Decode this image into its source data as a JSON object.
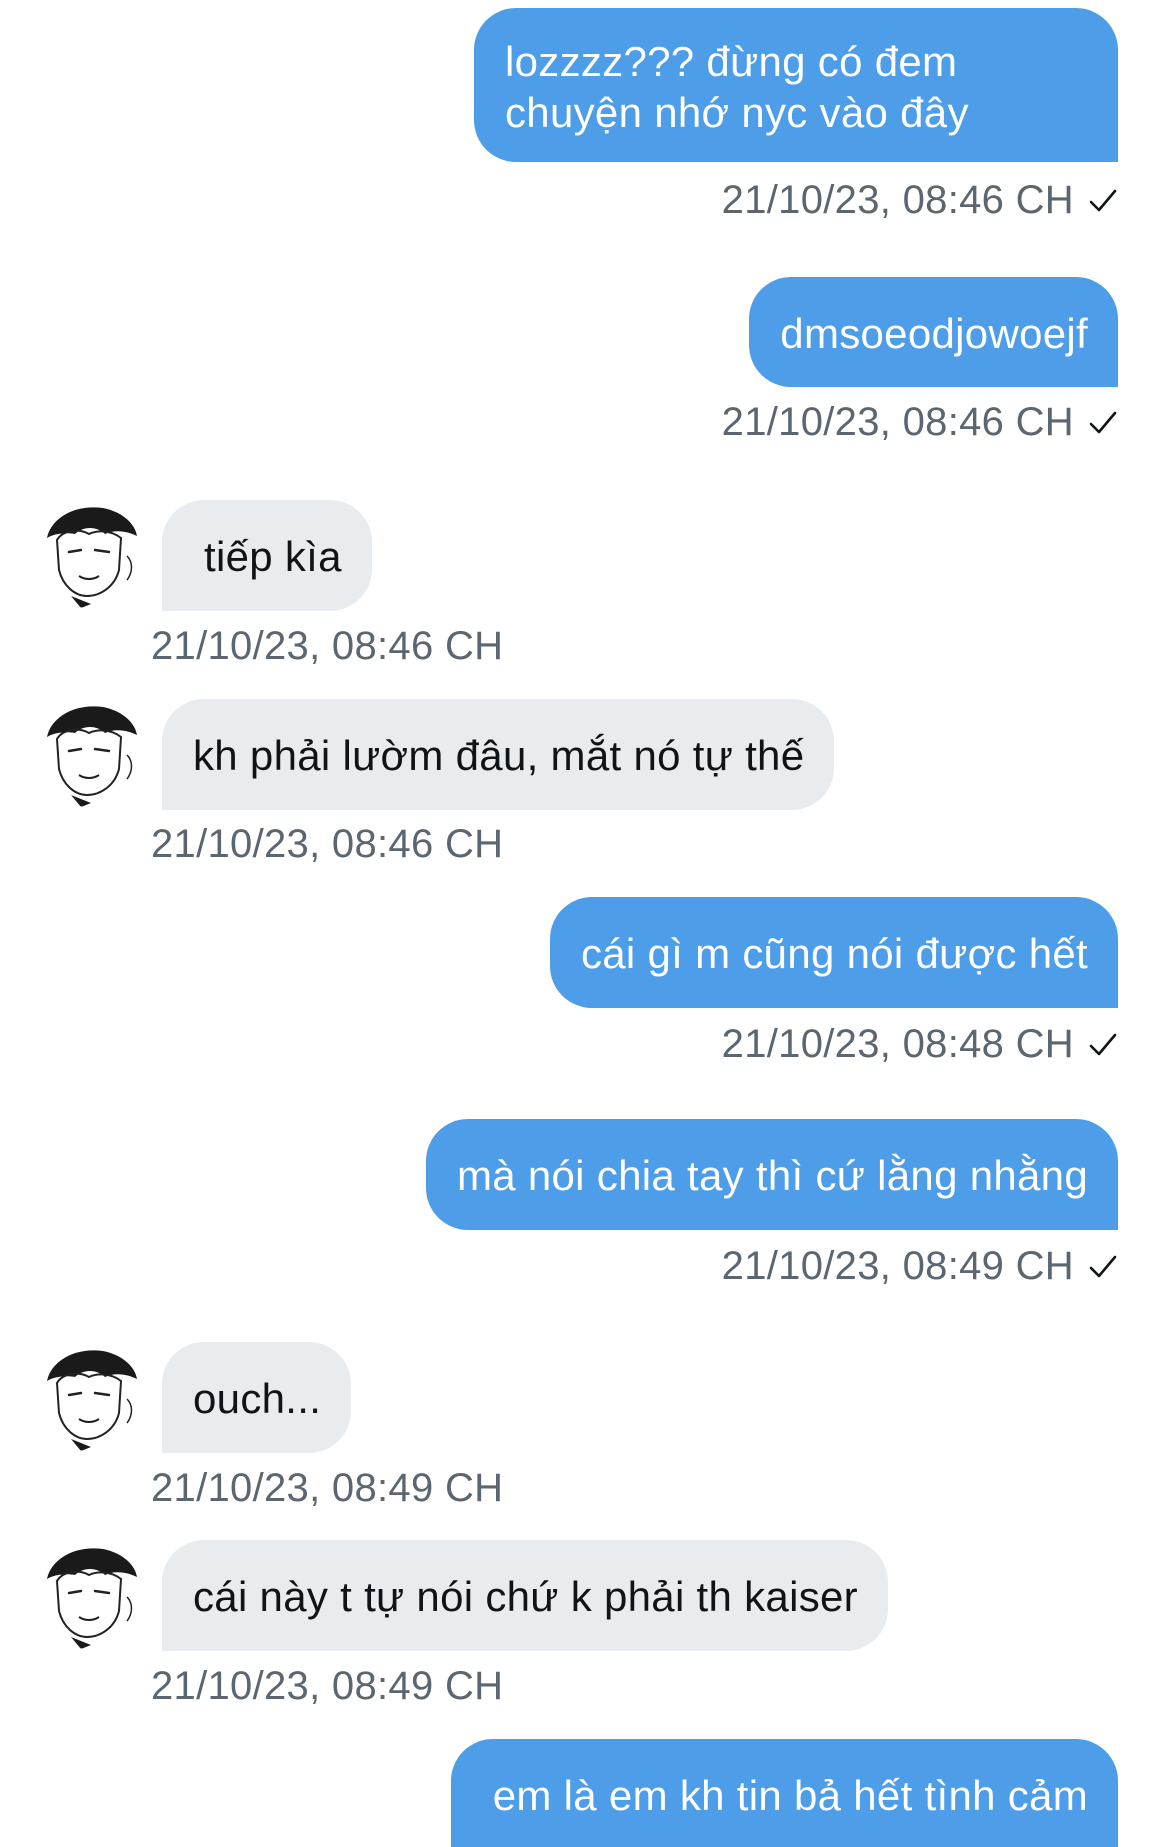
{
  "messages": [
    {
      "direction": "out",
      "text": "lozzzz??? đừng có đem chuyện nhớ nyc vào đây",
      "timestamp": "21/10/23, 08:46 CH",
      "status": "sent"
    },
    {
      "direction": "out",
      "text": "dmsoeodjowoejf",
      "timestamp": "21/10/23, 08:46 CH",
      "status": "sent"
    },
    {
      "direction": "in",
      "text": "tiếp kìa",
      "timestamp": "21/10/23, 08:46 CH"
    },
    {
      "direction": "in",
      "text": "kh phải lườm đâu, mắt nó tự thế",
      "timestamp": "21/10/23, 08:46 CH"
    },
    {
      "direction": "out",
      "text": "cái gì m cũng nói được hết",
      "timestamp": "21/10/23, 08:48 CH",
      "status": "sent"
    },
    {
      "direction": "out",
      "text": "mà nói chia tay thì cứ lằng nhằng",
      "timestamp": "21/10/23, 08:49 CH",
      "status": "sent"
    },
    {
      "direction": "in",
      "text": "ouch...",
      "timestamp": "21/10/23, 08:49 CH"
    },
    {
      "direction": "in",
      "text": "cái này t tự nói chứ k phải th kaiser",
      "timestamp": "21/10/23, 08:49 CH"
    },
    {
      "direction": "out",
      "text": "em là em kh tin bả hết tình cảm",
      "timestamp": "",
      "status": ""
    }
  ],
  "colors": {
    "outgoing_bubble": "#4d9de8",
    "incoming_bubble": "#e9ecef",
    "timestamp": "#5b6670",
    "background": "#ffffff"
  },
  "icons": {
    "read_receipt": "checkmark-icon",
    "avatar": "manga-character-avatar"
  }
}
